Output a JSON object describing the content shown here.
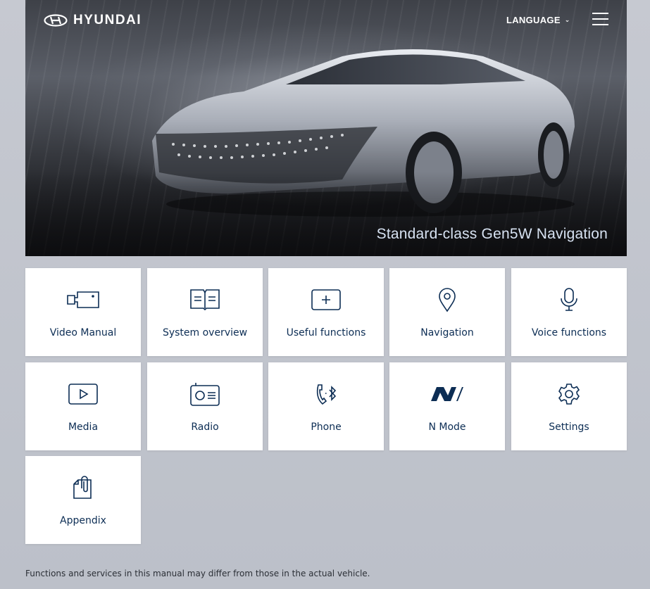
{
  "header": {
    "logo_text": "HYUNDAI",
    "language_label": "LANGUAGE",
    "hero_title": "Standard-class Gen5W Navigation"
  },
  "tiles": [
    {
      "label": "Video Manual",
      "icon": "video-camera-icon"
    },
    {
      "label": "System overview",
      "icon": "book-icon"
    },
    {
      "label": "Useful functions",
      "icon": "plus-box-icon"
    },
    {
      "label": "Navigation",
      "icon": "map-pin-icon"
    },
    {
      "label": "Voice functions",
      "icon": "microphone-icon"
    },
    {
      "label": "Media",
      "icon": "play-icon"
    },
    {
      "label": "Radio",
      "icon": "radio-icon"
    },
    {
      "label": "Phone",
      "icon": "bluetooth-phone-icon"
    },
    {
      "label": "N Mode",
      "icon": "n-logo-icon"
    },
    {
      "label": "Settings",
      "icon": "gear-icon"
    },
    {
      "label": "Appendix",
      "icon": "clip-document-icon"
    }
  ],
  "footer": {
    "note": "Functions and services in this manual may differ from those in the actual vehicle."
  },
  "colors": {
    "accent": "#0c2d54",
    "hero_title": "#d7e2f2",
    "background": "#c3c6ce"
  }
}
